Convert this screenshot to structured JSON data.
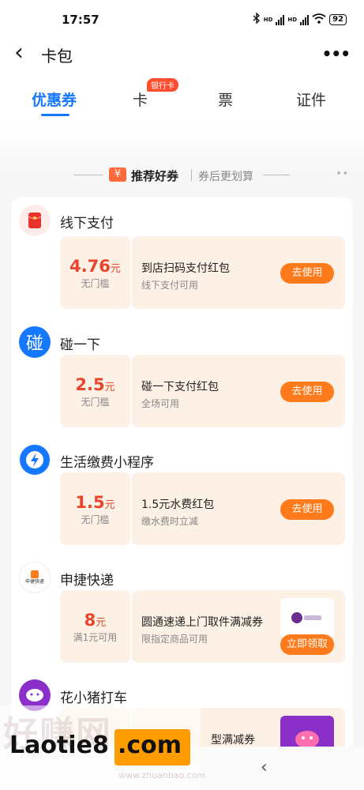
{
  "status_bar": {
    "time": "17:57",
    "hd1": "HD",
    "hd2": "HD",
    "battery": "92"
  },
  "header": {
    "back_icon": "‹",
    "title": "卡包",
    "more_icon": "•••"
  },
  "tabs": {
    "items": [
      {
        "label": "优惠券",
        "active": true
      },
      {
        "label": "卡",
        "active": false
      },
      {
        "label": "票",
        "active": false
      },
      {
        "label": "证件",
        "active": false
      }
    ],
    "card_badge": "银行卡"
  },
  "section": {
    "icon": "¥",
    "title": "推荐好券",
    "subtitle": "券后更划算"
  },
  "merchants": [
    {
      "name": "线下支付",
      "icon": "red-envelope-icon",
      "coupon": {
        "amount": "4.76",
        "unit": "元",
        "condition": "无门槛",
        "title": "到店扫码支付红包",
        "desc": "线下支付可用",
        "button": "去使用"
      }
    },
    {
      "name": "碰一下",
      "icon": "peng-icon",
      "logo_text": "碰",
      "coupon": {
        "amount": "2.5",
        "unit": "元",
        "condition": "无门槛",
        "title": "碰一下支付红包",
        "desc": "全场可用",
        "button": "去使用"
      }
    },
    {
      "name": "生活缴费小程序",
      "icon": "lightning-icon",
      "coupon": {
        "amount": "1.5",
        "unit": "元",
        "condition": "无门槛",
        "title": "1.5元水费红包",
        "desc": "缴水费时立减",
        "button": "去使用"
      }
    },
    {
      "name": "申捷快递",
      "icon": "shenjie-logo-icon",
      "logo_text": "申捷快递",
      "coupon": {
        "amount": "8",
        "unit": "元",
        "condition": "满1元可用",
        "title": "圆通速递上门取件满减券",
        "desc": "限指定商品可用",
        "button": "立即领取"
      }
    },
    {
      "name": "花小猪打车",
      "icon": "pig-logo-icon",
      "coupon": {
        "title": "型满减券"
      }
    }
  ],
  "watermark": {
    "brand": "Laotie8",
    "domain": ".com",
    "sub": "www.zhuanbao.com"
  },
  "nav": {
    "back_icon": "‹"
  }
}
